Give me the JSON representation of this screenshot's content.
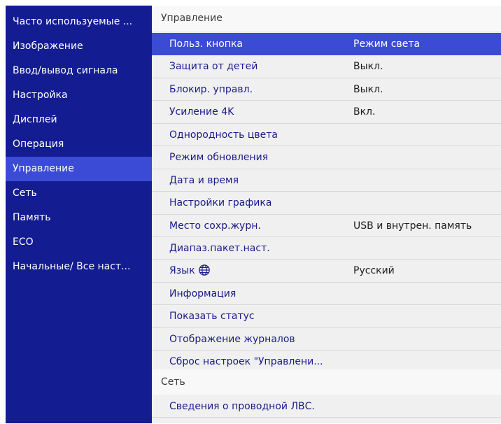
{
  "sidebar": {
    "items": [
      {
        "label": "Часто используемые ..."
      },
      {
        "label": "Изображение"
      },
      {
        "label": "Ввод/вывод сигнала"
      },
      {
        "label": "Настройка"
      },
      {
        "label": "Дисплей"
      },
      {
        "label": "Операция"
      },
      {
        "label": "Управление",
        "selected": true
      },
      {
        "label": "Сеть"
      },
      {
        "label": "Память"
      },
      {
        "label": "ECO"
      },
      {
        "label": "Начальные/ Все наст..."
      }
    ]
  },
  "main": {
    "section1": {
      "title": "Управление",
      "items": [
        {
          "label": "Польз. кнопка",
          "value": "Режим света",
          "selected": true
        },
        {
          "label": "Защита от детей",
          "value": "Выкл."
        },
        {
          "label": "Блокир. управл.",
          "value": "Выкл."
        },
        {
          "label": "Усиление 4K",
          "value": "Вкл."
        },
        {
          "label": "Однородность цвета",
          "value": ""
        },
        {
          "label": "Режим обновления",
          "value": ""
        },
        {
          "label": "Дата и время",
          "value": ""
        },
        {
          "label": "Настройки графика",
          "value": ""
        },
        {
          "label": "Место сохр.журн.",
          "value": "USB и внутрен. память"
        },
        {
          "label": "Диапаз.пакет.наст.",
          "value": ""
        },
        {
          "label": "Язык",
          "value": "Русский",
          "icon": "globe-icon"
        },
        {
          "label": "Информация",
          "value": ""
        },
        {
          "label": "Показать статус",
          "value": ""
        },
        {
          "label": "Отображение журналов",
          "value": ""
        },
        {
          "label": "Сброс настроек \"Управлени...",
          "value": ""
        }
      ]
    },
    "section2": {
      "title": "Сеть",
      "items": [
        {
          "label": "Сведения о проводной ЛВС.",
          "value": ""
        }
      ]
    }
  },
  "colors": {
    "sidebar_bg": "#141c92",
    "selection": "#3b4bd6",
    "main_bg": "#f0f0f0",
    "item_text": "#1a1a8c"
  }
}
